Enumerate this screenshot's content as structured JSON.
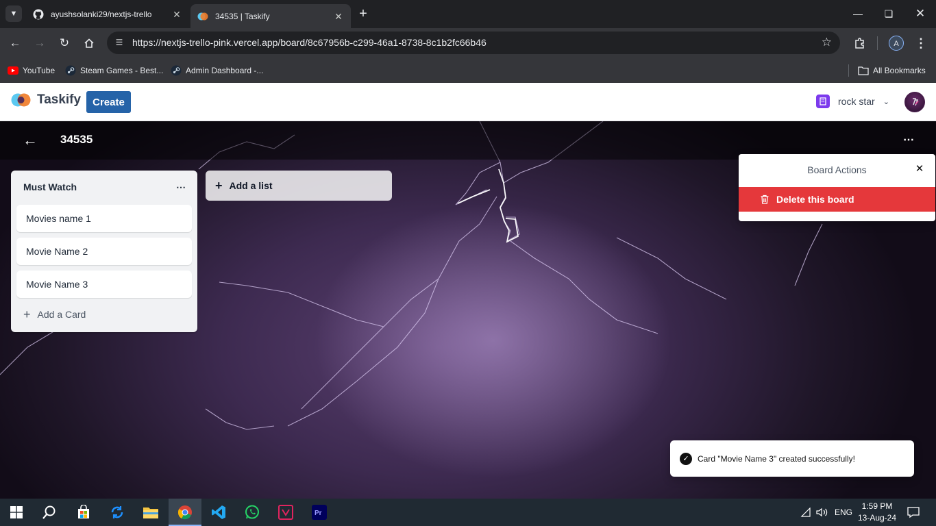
{
  "browser": {
    "tabs": [
      {
        "title": "ayushsolanki29/nextjs-trello",
        "active": false
      },
      {
        "title": "34535 | Taskify",
        "active": true
      }
    ],
    "url": "https://nextjs-trello-pink.vercel.app/board/8c67956b-c299-46a1-8738-8c1b2fc66b46",
    "profile_initial": "A",
    "bookmarks": [
      "YouTube",
      "Steam Games - Best...",
      "Admin Dashboard -..."
    ],
    "all_bookmarks": "All Bookmarks"
  },
  "app": {
    "logo_text": "Taskify",
    "create_label": "Create",
    "org_name": "rock star"
  },
  "board": {
    "title": "34535",
    "lists": [
      {
        "title": "Must Watch",
        "cards": [
          "Movies name 1",
          "Movie Name 2",
          "Movie Name 3"
        ],
        "add_card_label": "Add a Card"
      }
    ],
    "add_list_label": "Add a list"
  },
  "popover": {
    "title": "Board Actions",
    "delete_label": "Delete this board"
  },
  "toast": {
    "message": "Card \"Movie Name 3\" created successfully!"
  },
  "taskbar": {
    "language": "ENG",
    "time": "1:59 PM",
    "date": "13-Aug-24"
  },
  "colors": {
    "create_button": "#2563a8",
    "delete_button": "#e5383b",
    "org_icon": "#7c3aed"
  }
}
